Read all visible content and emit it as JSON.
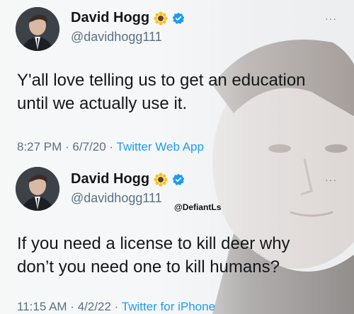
{
  "tweets": [
    {
      "display_name": "David Hogg",
      "handle": "@davidhogg111",
      "text_line1": "Y'all love telling us to get an education",
      "text_line2": "until we actually use it.",
      "time": "8:27 PM",
      "date": "6/7/20",
      "source": "Twitter Web App"
    },
    {
      "display_name": "David Hogg",
      "handle": "@davidhogg111",
      "text_line1": "If you need a license to kill deer why",
      "text_line2": "don’t you need one to kill humans?",
      "time": "11:15 AM",
      "date": "4/2/22",
      "source": "Twitter for iPhone"
    }
  ],
  "watermark": "@DefiantLs",
  "more_icon": "···",
  "separator": " · ",
  "icons": [
    "sunflower-icon",
    "verified-badge-icon",
    "more-options-icon"
  ],
  "colors": {
    "verified": "#1d9bf0",
    "source_link": "#1d9bf0",
    "sunflower": "#f5c518"
  }
}
